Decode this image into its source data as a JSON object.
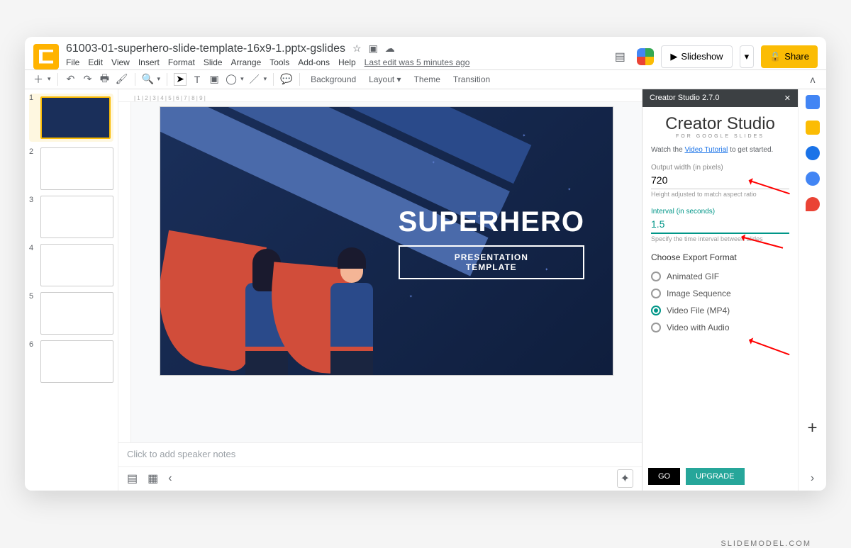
{
  "doc": {
    "title": "61003-01-superhero-slide-template-16x9-1.pptx-gslides",
    "last_edit": "Last edit was 5 minutes ago"
  },
  "menu": [
    "File",
    "Edit",
    "View",
    "Insert",
    "Format",
    "Slide",
    "Arrange",
    "Tools",
    "Add-ons",
    "Help"
  ],
  "header": {
    "slideshow": "Slideshow",
    "share": "Share"
  },
  "toolbar": {
    "background": "Background",
    "layout": "Layout",
    "theme": "Theme",
    "transition": "Transition"
  },
  "thumbs": [
    "1",
    "2",
    "3",
    "4",
    "5",
    "6"
  ],
  "slide": {
    "title": "SUPERHERO",
    "subtitle1": "PRESENTATION",
    "subtitle2": "TEMPLATE"
  },
  "notes": {
    "placeholder": "Click to add speaker notes"
  },
  "sidebar": {
    "title": "Creator Studio 2.7.0",
    "brand": "Creator Studio",
    "brand_sub": "FOR GOOGLE SLIDES",
    "watch_pre": "Watch the ",
    "watch_link": "Video Tutorial",
    "watch_post": " to get started.",
    "width_label": "Output width (in pixels)",
    "width_value": "720",
    "width_help": "Height adjusted to match aspect ratio",
    "interval_label": "Interval (in seconds)",
    "interval_value": "1.5",
    "interval_help": "Specify the time interval between slides",
    "export_header": "Choose Export Format",
    "opt_gif": "Animated GIF",
    "opt_seq": "Image Sequence",
    "opt_mp4": "Video File (MP4)",
    "opt_audio": "Video with Audio",
    "go": "GO",
    "upgrade": "UPGRADE"
  },
  "watermark": "SLIDEMODEL.COM"
}
